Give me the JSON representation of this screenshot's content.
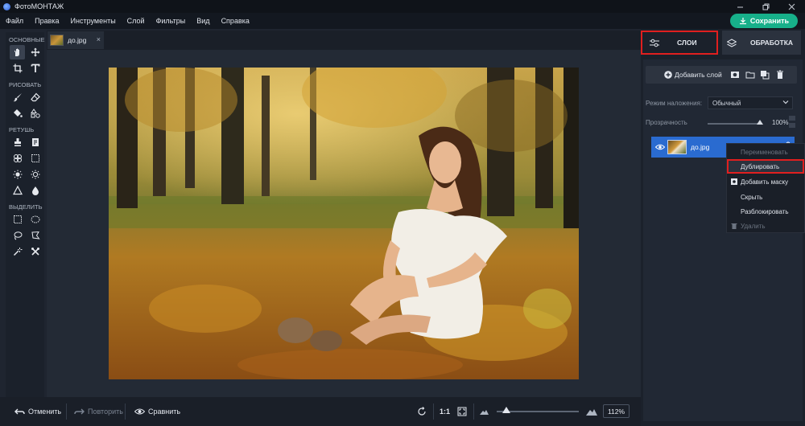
{
  "window": {
    "title": "ФотоМОНТАЖ"
  },
  "menu": [
    "Файл",
    "Правка",
    "Инструменты",
    "Слой",
    "Фильтры",
    "Вид",
    "Справка"
  ],
  "save_button": {
    "label": "Сохранить",
    "color": "#17b08a"
  },
  "toolbox": {
    "sections": [
      {
        "label": "ОСНОВНЫЕ",
        "tools": [
          "hand-icon",
          "move-icon",
          "crop-icon",
          "text-icon"
        ]
      },
      {
        "label": "РИСОВАТЬ",
        "tools": [
          "brush-icon",
          "eraser-icon",
          "fill-bucket-icon",
          "shapes-icon"
        ]
      },
      {
        "label": "РЕТУШЬ",
        "tools": [
          "stamp-icon",
          "patch-icon",
          "heal-icon",
          "frame-icon",
          "brighten-icon",
          "darken-icon",
          "sharpen-icon",
          "blur-icon"
        ]
      },
      {
        "label": "ВЫДЕЛИТЬ",
        "tools": [
          "rect-select-icon",
          "ellipse-select-icon",
          "lasso-icon",
          "polygon-lasso-icon",
          "magic-wand-icon",
          "select-tool-icon"
        ]
      }
    ]
  },
  "document_tab": {
    "name": "до.jpg",
    "close": "×"
  },
  "bottom_bar": {
    "undo": "Отменить",
    "redo": "Повторить",
    "compare": "Сравнить",
    "ratio": "1:1",
    "zoom": "112%",
    "zoom_fraction": 0.1
  },
  "panel": {
    "tabs": {
      "layers": "СЛОИ",
      "processing": "ОБРАБОТКА"
    },
    "add_layer": "Добавить слой",
    "blend_mode_label": "Режим наложения:",
    "blend_mode_value": "Обычный",
    "opacity_label": "Прозрачность",
    "opacity_value": "100%",
    "layer": {
      "name": "до.jpg"
    }
  },
  "context_menu": {
    "items": [
      {
        "label": "Переименовать",
        "state": "disabled"
      },
      {
        "label": "Дублировать",
        "state": "highlighted"
      },
      {
        "label": "Добавить маску",
        "state": "normal"
      },
      {
        "label": "Скрыть",
        "state": "normal"
      },
      {
        "label": "Разблокировать",
        "state": "normal"
      },
      {
        "label": "Удалить",
        "state": "disabled"
      }
    ]
  },
  "colors": {
    "accent": "#2a6bd0",
    "highlight_box": "#e01f1f",
    "background": "#1f2530"
  }
}
